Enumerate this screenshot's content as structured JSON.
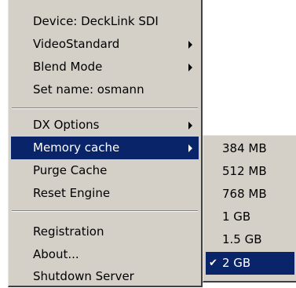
{
  "main_menu": {
    "items": [
      {
        "label": "Device: DeckLink SDI",
        "submenu": false
      },
      {
        "label": "VideoStandard",
        "submenu": true
      },
      {
        "label": "Blend Mode",
        "submenu": true
      },
      {
        "label": "Set name: osmann",
        "submenu": false
      },
      {
        "label": "DX Options",
        "submenu": true
      },
      {
        "label": "Memory cache",
        "submenu": true,
        "active": true
      },
      {
        "label": "Purge Cache",
        "submenu": false
      },
      {
        "label": "Reset Engine",
        "submenu": false
      },
      {
        "label": "Registration",
        "submenu": false
      },
      {
        "label": "About...",
        "submenu": false
      },
      {
        "label": "Shutdown Server",
        "submenu": false
      }
    ]
  },
  "memory_cache_submenu": {
    "items": [
      {
        "label": "384 MB",
        "checked": false
      },
      {
        "label": "512 MB",
        "checked": false
      },
      {
        "label": "768 MB",
        "checked": false
      },
      {
        "label": "1 GB",
        "checked": false
      },
      {
        "label": "1.5 GB",
        "checked": false
      },
      {
        "label": "2 GB",
        "checked": true
      }
    ],
    "check_glyph": "✔"
  },
  "colors": {
    "menu_background": "#d4d0c8",
    "highlight": "#0a246a",
    "highlight_text": "#ffffff"
  }
}
